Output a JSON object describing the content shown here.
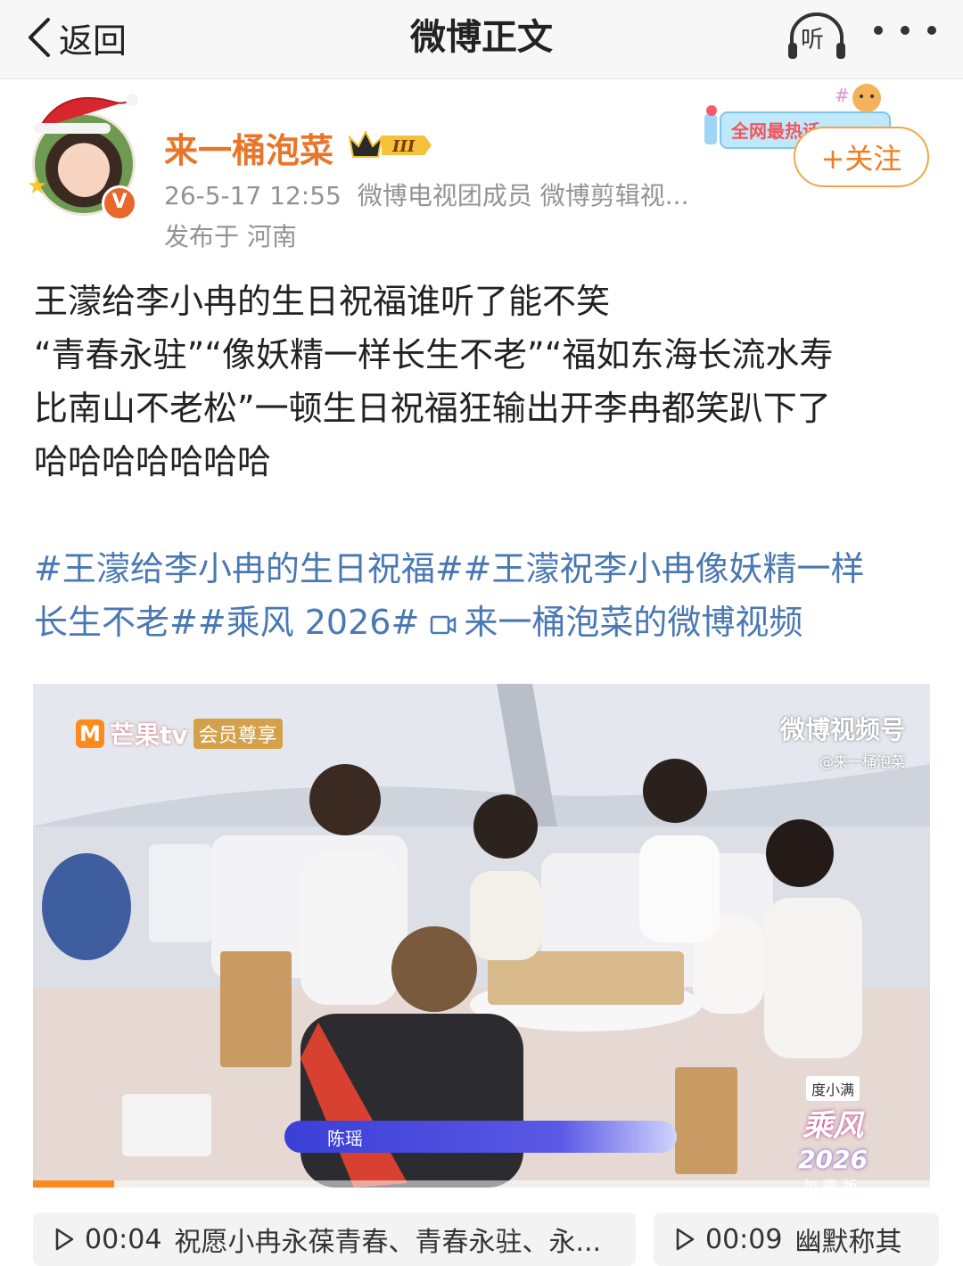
{
  "nav": {
    "back_label": "返回",
    "title": "微博正文",
    "listen_label": "听"
  },
  "author": {
    "name": "来一桶泡菜",
    "vip_level": "III",
    "time": "26-5-17 12:55",
    "tags": "微博电视团成员 微博剪辑视...",
    "location": "发布于 河南",
    "verified_mark": "V",
    "follow_label": "+关注",
    "banner_text": "全网最热话"
  },
  "post": {
    "lines": [
      "王濛给李小冉的生日祝福谁听了能不笑",
      "“青春永驻”“像妖精一样长生不老”“福如东海长流水寿",
      "比南山不老松”一顿生日祝福狂输出开李冉都笑趴下了",
      "哈哈哈哈哈哈哈"
    ],
    "topic_lines": [
      "#王濛给李小冉的生日祝福##王濛祝李小冉像妖精一样",
      "长生不老##乘风 2026# "
    ],
    "video_link": "来一桶泡菜的微博视频"
  },
  "video": {
    "mango_brand": "芒果tv",
    "member_tag": "会员尊享",
    "weibo_mark": "微博视频号",
    "weibo_user": "@来一桶泡菜",
    "name_tag": "陈瑶",
    "sponsor": "度小满",
    "show_title": "乘风",
    "show_year": "2026",
    "show_edition": "加更版",
    "progress": 0.09
  },
  "chapters": [
    {
      "time": "00:04",
      "text": "祝愿小冉永葆青春、青春永驻、永..."
    },
    {
      "time": "00:09",
      "text": "幽默称其"
    }
  ],
  "colors": {
    "accent_orange": "#e8762a",
    "link_blue": "#4a78b3",
    "meta_gray": "#939393"
  }
}
